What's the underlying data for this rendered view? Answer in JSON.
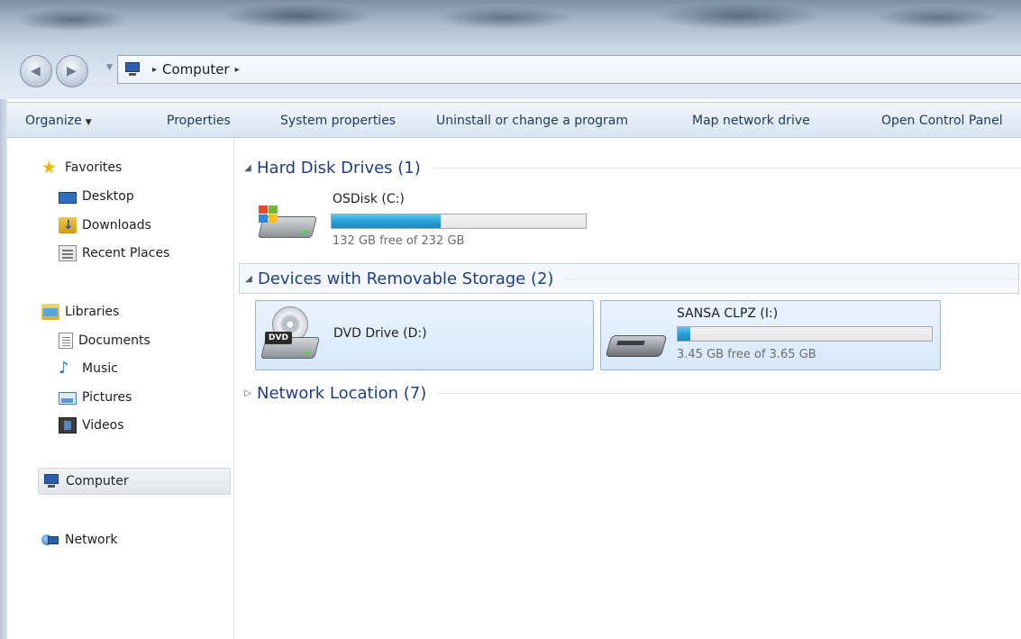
{
  "window": {
    "address": {
      "crumbs": [
        "Computer"
      ],
      "separator_glyph": "▸"
    }
  },
  "commandbar": {
    "organize": "Organize",
    "properties": "Properties",
    "system_properties": "System properties",
    "uninstall": "Uninstall or change a program",
    "map_network_drive": "Map network drive",
    "open_control_panel": "Open Control Panel"
  },
  "navpane": {
    "favorites": {
      "label": "Favorites",
      "items": [
        "Desktop",
        "Downloads",
        "Recent Places"
      ]
    },
    "libraries": {
      "label": "Libraries",
      "items": [
        "Documents",
        "Music",
        "Pictures",
        "Videos"
      ]
    },
    "computer": "Computer",
    "network": "Network",
    "selected": "Computer"
  },
  "content": {
    "groups": [
      {
        "title": "Hard Disk Drives (1)",
        "expanded": true,
        "drives": [
          {
            "name": "OSDisk (C:)",
            "free_text": "132 GB free of 232 GB",
            "used_fraction": 0.43,
            "icon": "hard-disk-icon"
          }
        ]
      },
      {
        "title": "Devices with Removable Storage (2)",
        "expanded": true,
        "drives": [
          {
            "name": "DVD Drive (D:)",
            "icon": "dvd-drive-icon",
            "icon_label": "DVD"
          },
          {
            "name": "SANSA CLPZ (I:)",
            "free_text": "3.45 GB free of 3.65 GB",
            "used_fraction": 0.05,
            "icon": "usb-drive-icon"
          }
        ]
      },
      {
        "title": "Network Location (7)",
        "expanded": false
      }
    ]
  },
  "colors": {
    "accent_fill": "#27a2d8",
    "group_title": "#1e3f86",
    "selection_border": "#93b8e4"
  }
}
